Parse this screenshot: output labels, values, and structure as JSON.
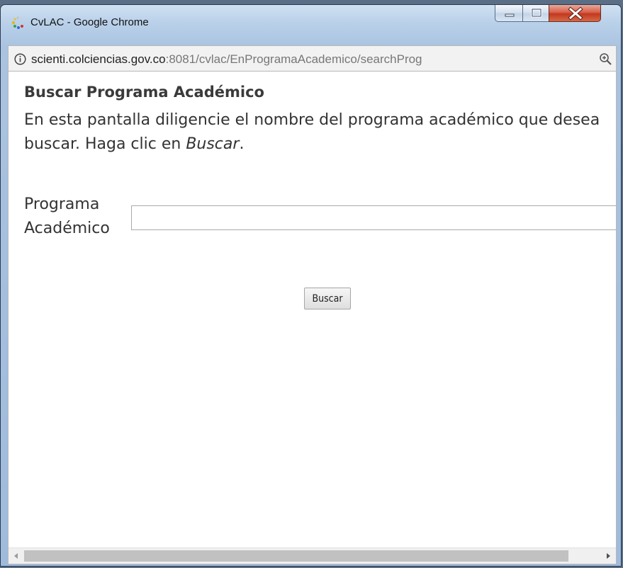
{
  "window": {
    "title": "CvLAC - Google Chrome"
  },
  "addressbar": {
    "host": "scienti.colciencias.gov.co",
    "path": ":8081/cvlac/EnProgramaAcademico/searchProg"
  },
  "page": {
    "heading": "Buscar Programa Académico",
    "instruction_prefix": "En esta pantalla diligencie el nombre del programa académico que desea buscar. Haga clic en ",
    "instruction_emphasis": "Buscar",
    "instruction_suffix": ".",
    "field_label_line1": "Programa",
    "field_label_line2": "Académico",
    "field_value": "",
    "search_button_label": "Buscar"
  },
  "icons": {
    "app": "chrome-loading-icon",
    "info": "info-icon",
    "zoom": "zoom-icon",
    "minimize": "minimize-icon",
    "maximize": "maximize-icon",
    "close": "close-icon"
  },
  "colors": {
    "close_button": "#c2381f",
    "frame": "#b9d0e9",
    "text": "#333333"
  }
}
